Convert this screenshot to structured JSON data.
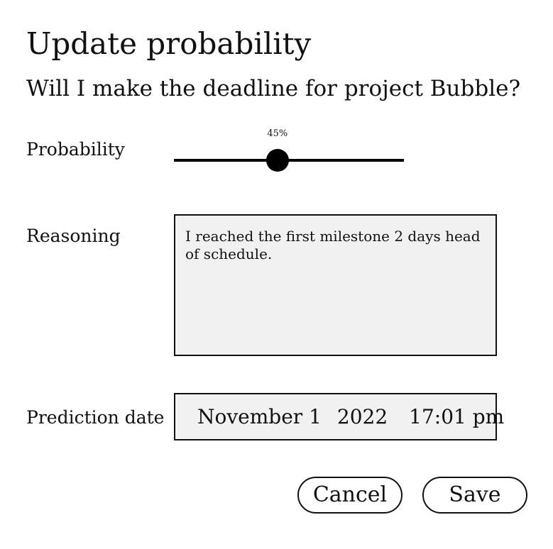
{
  "dialog": {
    "title": "Update probability",
    "question": "Will I make the deadline for project Bubble?"
  },
  "probability": {
    "label": "Probability",
    "value": 0.45,
    "display": "45%"
  },
  "reasoning": {
    "label": "Reasoning",
    "text": "I reached the first milestone 2 days head of schedule."
  },
  "prediction_date": {
    "label": "Prediction date",
    "date": "November 1",
    "year": "2022",
    "time": "17:01 pm"
  },
  "buttons": {
    "cancel": "Cancel",
    "save": "Save"
  },
  "colors": {
    "field_background": "#f1f1f1",
    "ink": "#111111"
  }
}
